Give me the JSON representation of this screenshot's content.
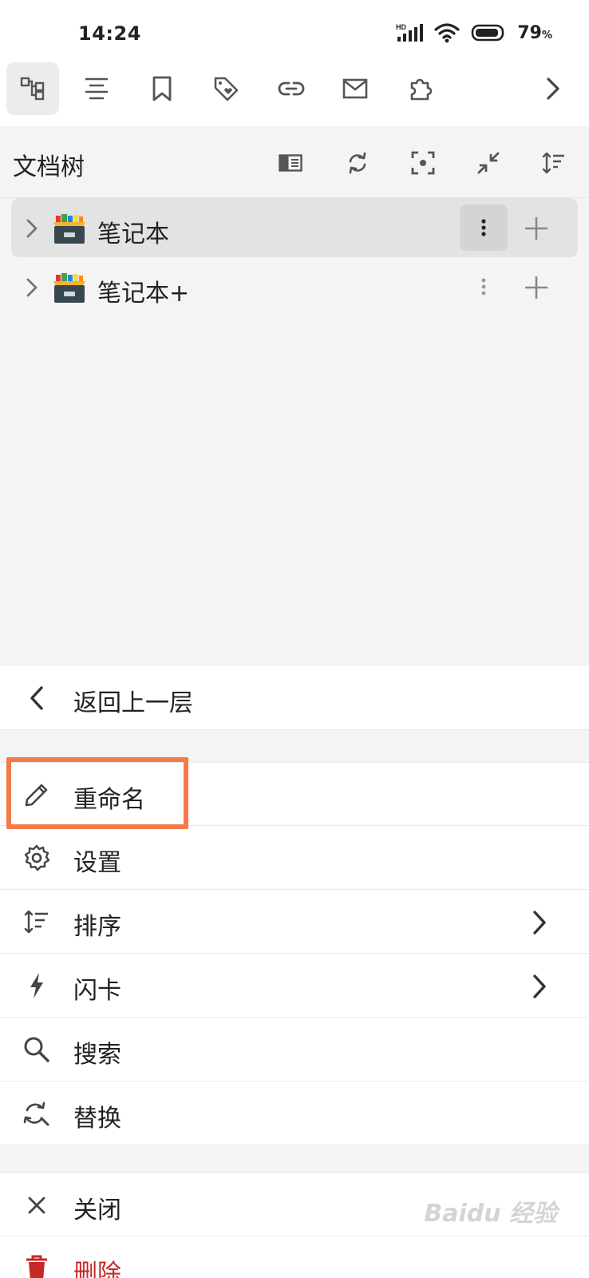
{
  "status_bar": {
    "time": "14:24",
    "network": "HD",
    "battery_percent": "79",
    "battery_unit": "%"
  },
  "toolbar": {
    "icons": [
      "file-tree-icon",
      "outline-icon",
      "bookmark-icon",
      "tag-icon",
      "backlink-icon",
      "inbox-icon",
      "plugin-icon",
      "chevron-right-icon"
    ],
    "active_index": 0
  },
  "doc_tree": {
    "title": "文档树",
    "header_icons": [
      "sidebar-toggle-icon",
      "refresh-icon",
      "focus-icon",
      "collapse-icon",
      "sort-icon"
    ],
    "notebooks": [
      {
        "label": "笔记本",
        "selected": true
      },
      {
        "label": "笔记本+",
        "selected": false
      }
    ]
  },
  "menu": {
    "back_label": "返回上一层",
    "items": [
      {
        "label": "重命名",
        "icon": "pencil-icon",
        "submenu": false
      },
      {
        "label": "设置",
        "icon": "gear-icon",
        "submenu": false
      },
      {
        "label": "排序",
        "icon": "sort-icon",
        "submenu": true
      },
      {
        "label": "闪卡",
        "icon": "lightning-icon",
        "submenu": true
      },
      {
        "label": "搜索",
        "icon": "search-icon",
        "submenu": false
      },
      {
        "label": "替换",
        "icon": "replace-icon",
        "submenu": false
      }
    ],
    "close_label": "关闭",
    "delete_label": "删除"
  },
  "colors": {
    "highlight": "#f47a4a",
    "danger": "#c62828",
    "icon": "#444444"
  },
  "watermark": "Baidu 经验"
}
